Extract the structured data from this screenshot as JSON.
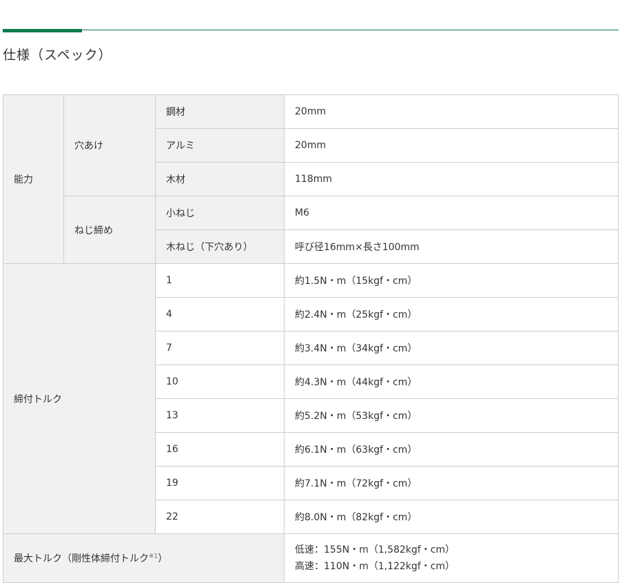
{
  "section_title": "仕様（スペック）",
  "capacity": {
    "label": "能力",
    "drilling": {
      "label": "穴あけ",
      "rows": [
        {
          "item": "鋼材",
          "value": "20mm"
        },
        {
          "item": "アルミ",
          "value": "20mm"
        },
        {
          "item": "木材",
          "value": "118mm"
        }
      ]
    },
    "screwing": {
      "label": "ねじ締め",
      "rows": [
        {
          "item": "小ねじ",
          "value": "M6"
        },
        {
          "item": "木ねじ（下穴あり）",
          "value": "呼び径16mm×長さ100mm"
        }
      ]
    }
  },
  "torque": {
    "label": "締付トルク",
    "rows": [
      {
        "setting": "1",
        "value": "約1.5N・m（15kgf・cm）"
      },
      {
        "setting": "4",
        "value": "約2.4N・m（25kgf・cm）"
      },
      {
        "setting": "7",
        "value": "約3.4N・m（34kgf・cm）"
      },
      {
        "setting": "10",
        "value": "約4.3N・m（44kgf・cm）"
      },
      {
        "setting": "13",
        "value": "約5.2N・m（53kgf・cm）"
      },
      {
        "setting": "16",
        "value": "約6.1N・m（63kgf・cm）"
      },
      {
        "setting": "19",
        "value": "約7.1N・m（72kgf・cm）"
      },
      {
        "setting": "22",
        "value": "約8.0N・m（82kgf・cm）"
      }
    ]
  },
  "max_torque": {
    "label": "最大トルク（剛性体締付トルク",
    "note_mark": "※1",
    "label_close": "）",
    "low": "低速：155N・m（1,582kgf・cm）",
    "high": "高速：110N・m（1,122kgf・cm）"
  }
}
